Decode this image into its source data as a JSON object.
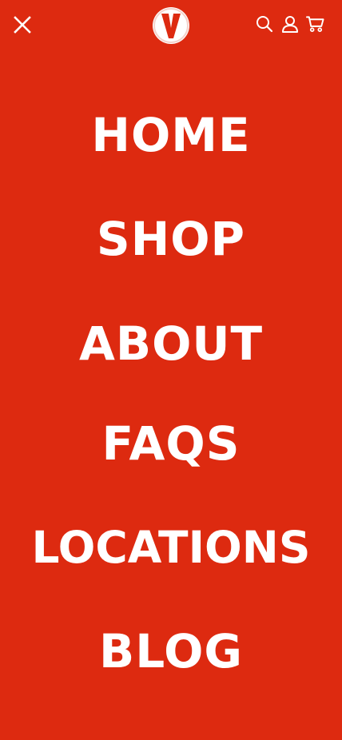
{
  "brand": {
    "logo_letter": "V",
    "logo_color": "#dd2a10"
  },
  "colors": {
    "background": "#dd2a10",
    "foreground": "#ffffff"
  },
  "header": {
    "close_icon": "close-icon",
    "icons": [
      "search-icon",
      "user-icon",
      "cart-icon"
    ]
  },
  "nav": {
    "items": [
      {
        "label": "HOME"
      },
      {
        "label": "SHOP"
      },
      {
        "label": "ABOUT"
      },
      {
        "label": "FAQS"
      },
      {
        "label": "LOCATIONS"
      },
      {
        "label": "BLOG"
      }
    ]
  }
}
